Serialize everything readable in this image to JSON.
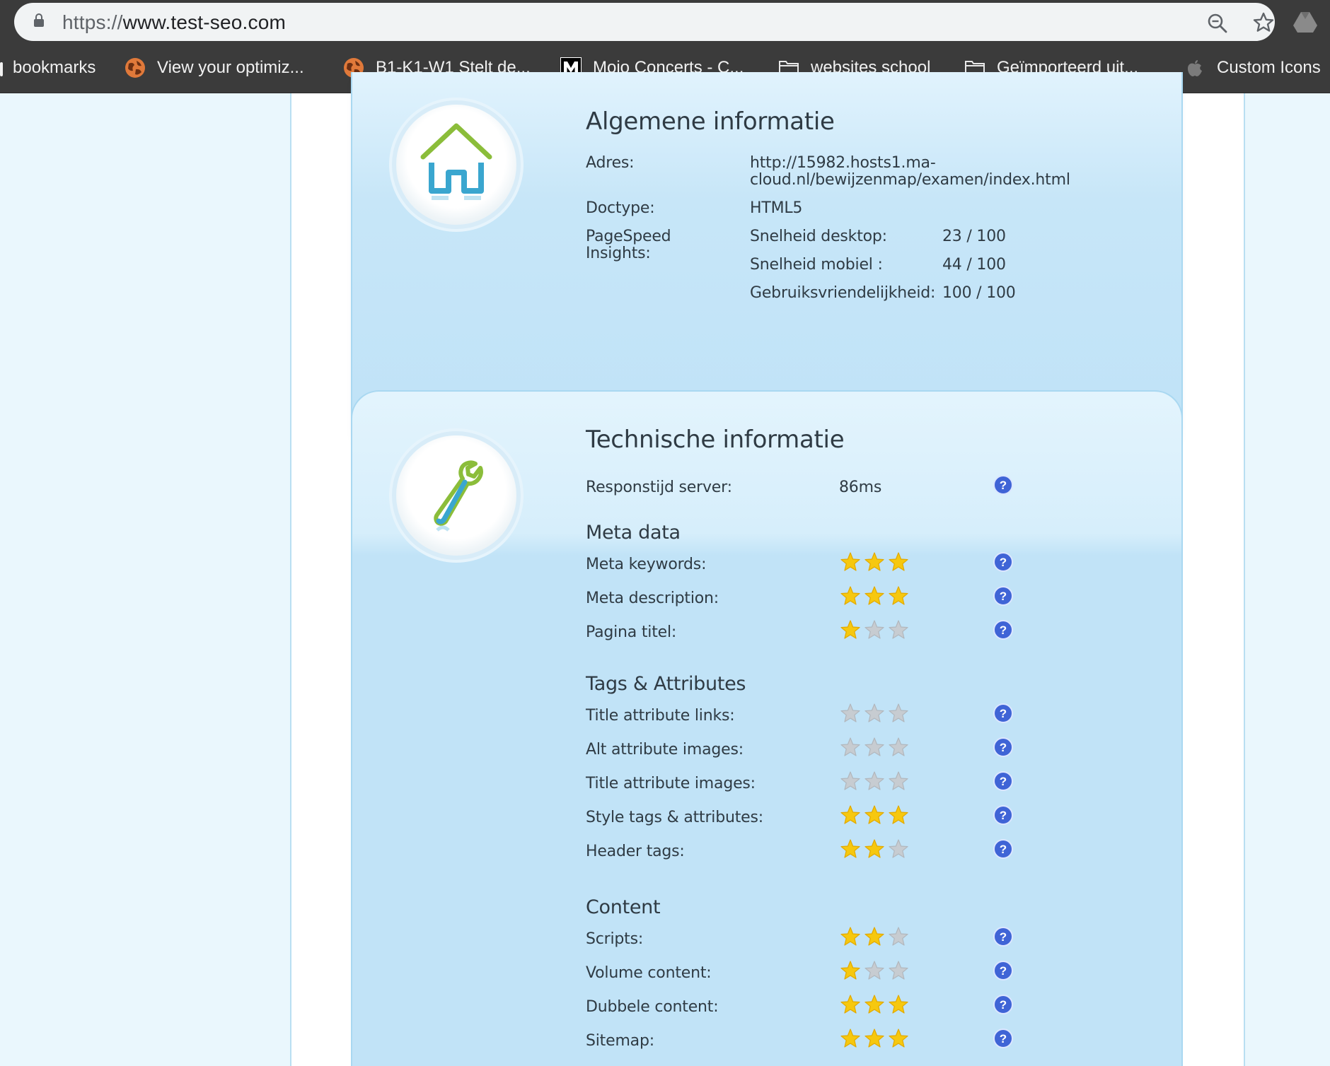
{
  "browser": {
    "url_scheme": "https://",
    "url_host": "www.test-seo.com"
  },
  "bookmarks": [
    {
      "label": "bookmarks",
      "icon": "folder-icon"
    },
    {
      "label": "View your optimiz...",
      "icon": "globe-icon"
    },
    {
      "label": "B1-K1-W1 Stelt de...",
      "icon": "globe-icon"
    },
    {
      "label": "Mojo Concerts - C...",
      "icon": "mojo-logo-icon"
    },
    {
      "label": "websites school",
      "icon": "folder-icon"
    },
    {
      "label": "Geïmporteerd uit...",
      "icon": "folder-icon"
    },
    {
      "label": "Custom Icons",
      "icon": "apple-icon"
    }
  ],
  "algemeen": {
    "title": "Algemene informatie",
    "adres_label": "Adres:",
    "adres_value_1": "http://15982.hosts1.ma-",
    "adres_value_2": "cloud.nl/bewijzenmap/examen/index.html",
    "doctype_label": "Doctype:",
    "doctype_value": "HTML5",
    "pagespeed_label_1": "PageSpeed",
    "pagespeed_label_2": "Insights:",
    "speed": [
      {
        "label": "Snelheid desktop:",
        "value": "23 / 100"
      },
      {
        "label": "Snelheid mobiel :",
        "value": "44 / 100"
      },
      {
        "label": "Gebruiksvriendelijkheid:",
        "value": "100 / 100"
      }
    ]
  },
  "technisch": {
    "title": "Technische informatie",
    "response_label": "Responstijd server:",
    "response_value": "86ms",
    "sections": [
      {
        "heading": "Meta data",
        "rows": [
          {
            "label": "Meta keywords:",
            "rating": 3
          },
          {
            "label": "Meta description:",
            "rating": 3
          },
          {
            "label": "Pagina titel:",
            "rating": 1
          }
        ]
      },
      {
        "heading": "Tags & Attributes",
        "rows": [
          {
            "label": "Title attribute links:",
            "rating": 0
          },
          {
            "label": "Alt attribute images:",
            "rating": 0
          },
          {
            "label": "Title attribute images:",
            "rating": 0
          },
          {
            "label": "Style tags & attributes:",
            "rating": 3
          },
          {
            "label": "Header tags:",
            "rating": 2
          }
        ]
      },
      {
        "heading": "Content",
        "rows": [
          {
            "label": "Scripts:",
            "rating": 2
          },
          {
            "label": "Volume content:",
            "rating": 1
          },
          {
            "label": "Dubbele content:",
            "rating": 3
          },
          {
            "label": "Sitemap:",
            "rating": 3
          }
        ]
      }
    ],
    "max_rating": 3
  },
  "colors": {
    "star_on": "#f6c80f",
    "star_off": "#c7ccd1",
    "help_blue": "#3f64d6",
    "house_green": "#8bbd3a",
    "house_blue": "#3aa6cf"
  }
}
